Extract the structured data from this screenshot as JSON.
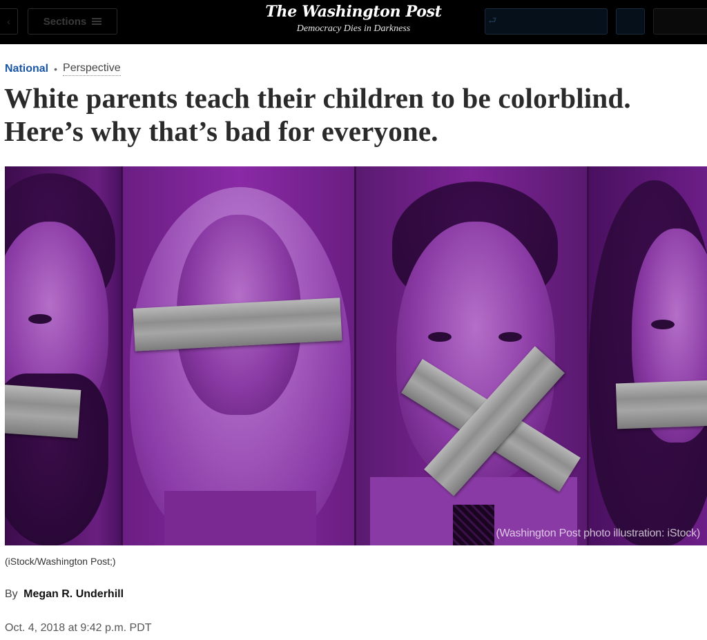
{
  "header": {
    "sections_label": "Sections",
    "logo": "The Washington Post",
    "tagline": "Democracy Dies in Darkness"
  },
  "kicker": {
    "section": "National",
    "label": "Perspective"
  },
  "headline": "White parents teach their children to be colorblind. Here’s why that’s bad for everyone.",
  "hero": {
    "credit_overlay": "(Washington Post photo illustration: iStock)",
    "colors": {
      "tint": "#7a2296",
      "tape": "#9e9e9e"
    }
  },
  "caption": "(iStock/Washington Post;)",
  "byline": {
    "prefix": "By",
    "author": "Megan R. Underhill"
  },
  "timestamp": "Oct. 4, 2018 at 9:42 p.m. PDT",
  "colors": {
    "section_link": "#1955a5",
    "masthead_bg": "#000000"
  }
}
